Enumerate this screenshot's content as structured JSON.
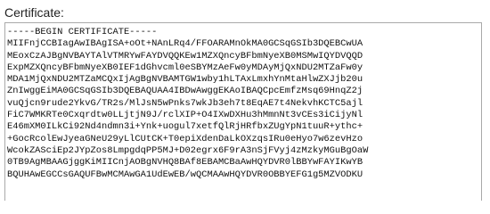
{
  "certificate": {
    "label": "Certificate:",
    "lines": [
      "-----BEGIN CERTIFICATE-----",
      "MIIFnjCCBIagAwIBAgISA+oOt+NAnLRq4/FFOARAMnOkMA0GCSqGSIb3DQEBCwUA",
      "MEoxCzAJBgNVBAYTAlVTMRYwFAYDVQQKEw1MZXQncyBFbmNyeXB0MSMwIQYDVQQD",
      "ExpMZXQncyBFbmNyeXB0IEF1dGhvcml0eSBYMzAeFw0yMDAyMjQxNDU2MTZaFw0y",
      "MDA1MjQxNDU2MTZaMCQxIjAgBgNVBAMTGW1wby1hLTAxLmxhYnMtaHlwZXJjb20u",
      "ZnIwggEiMA0GCSqGSIb3DQEBAQUAA4IBDwAwggEKAoIBAQCpcEmfzMsq69HnqZ2j",
      "vuQjcn9rude2YkvG/TR2s/MlJsN5wPnks7wkJb3eh7t8EqAE7t4NekvhKCTC5ajl",
      "FiC7WMKRTe0Cxqrdtw0LLjtjN9J/rclXIP+O4IXwDXHu3hMmnNt3vCEs3iCijyNl",
      "E46mXM0ILkCi92Nd4ndmn3i+Ynk+uogul7xetfQlRjHRfbxZUgYpN1tuuR+ythc+",
      "+GocRcolEwJyeaGNeU29yLlCUtCK+T0epiXdenDaLkOXzqsIRu0eHyo7w6zevHzo",
      "WcokZASciEp2JYpZos8LmpgdqPP5MJ+D02egrx6F9rA3nSjFVyj4zMzkyMGuBgOaW",
      "0TB9AgMBAAGjggKiMIICnjAOBgNVHQ8BAf8EBAMCBaAwHQYDVR0lBBYwFAYIKwYB",
      "BQUHAwEGCCsGAQUFBwMCMAwGA1UdEwEB/wQCMAAwHQYDVR0OBBYEFG1g5MZVODKU"
    ]
  }
}
